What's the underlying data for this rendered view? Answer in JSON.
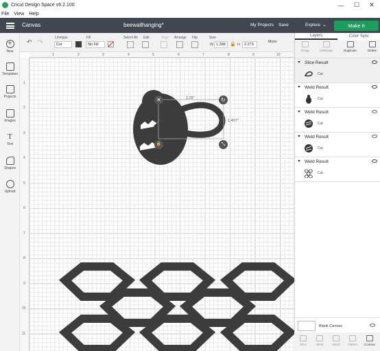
{
  "window": {
    "title": "Cricut Design Space  v6.2.100",
    "min": "—",
    "max": "☐",
    "close": "✕"
  },
  "menu": [
    "File",
    "View",
    "Help"
  ],
  "header": {
    "section": "Canvas",
    "doc_title": "beewallhanging*",
    "my_projects": "My Projects",
    "save": "Save",
    "explore": "Explore",
    "make_it": "Make It"
  },
  "toolbar": {
    "linetype_label": "Linetype",
    "linetype_value": "Cut",
    "fill_label": "Fill",
    "fill_value": "No Fill",
    "select_all": "Select All",
    "edit": "Edit",
    "align": "Align",
    "arrange": "Arrange",
    "flip": "Flip",
    "size_label": "Size",
    "w_label": "W",
    "w_value": "1.398",
    "h_label": "H",
    "h_value": "2.273",
    "more": "More"
  },
  "sidebar": [
    {
      "label": "New",
      "icon": "plus-icon"
    },
    {
      "label": "Templates",
      "icon": "shirt-icon"
    },
    {
      "label": "Projects",
      "icon": "projects-icon"
    },
    {
      "label": "Images",
      "icon": "image-icon"
    },
    {
      "label": "Text",
      "icon": "text-icon"
    },
    {
      "label": "Shapes",
      "icon": "shapes-icon"
    },
    {
      "label": "Upload",
      "icon": "upload-icon"
    }
  ],
  "ruler": {
    "top": [
      "1",
      "2",
      "3",
      "4",
      "5",
      "6",
      "7",
      "8",
      "9",
      "10"
    ],
    "left": [
      "1",
      "2",
      "3",
      "4",
      "5",
      "6",
      "7",
      "8",
      "9",
      "10",
      "11"
    ]
  },
  "canvas": {
    "width_dim": "2.25\"",
    "height_dim": "1.407\""
  },
  "panel": {
    "tab_layers": "Layers",
    "tab_color_sync": "Color Sync",
    "actions": [
      "Group",
      "UnGroup",
      "Duplicate",
      "Delete"
    ],
    "layers": [
      {
        "title": "Slice Result",
        "op": "Cut"
      },
      {
        "title": "Weld Result",
        "op": "Cut"
      },
      {
        "title": "Weld Result",
        "op": "Cut"
      },
      {
        "title": "Weld Result",
        "op": "Cut"
      },
      {
        "title": "Weld Result",
        "op": "Cut"
      }
    ],
    "blank_canvas": "Blank Canvas",
    "bottom_actions": [
      "Slice",
      "Weld",
      "Attach",
      "Flatten",
      "Contour"
    ]
  },
  "colors": {
    "header": "#414750",
    "make_it": "#16a05c",
    "shape": "#3c3c3c"
  }
}
